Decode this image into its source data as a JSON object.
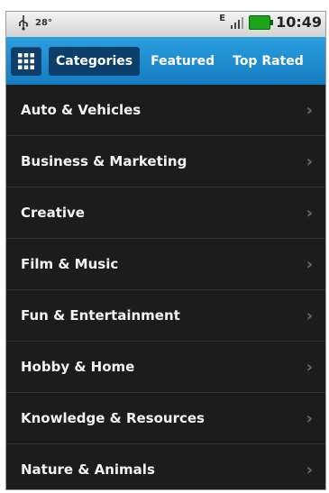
{
  "status_bar": {
    "temperature": "28°",
    "network": "E",
    "time": "10:49"
  },
  "tabs": [
    {
      "label": "Categories",
      "active": true
    },
    {
      "label": "Featured",
      "active": false
    },
    {
      "label": "Top Rated",
      "active": false
    }
  ],
  "categories": [
    {
      "label": "Auto & Vehicles"
    },
    {
      "label": "Business & Marketing"
    },
    {
      "label": "Creative"
    },
    {
      "label": "Film & Music"
    },
    {
      "label": "Fun & Entertainment"
    },
    {
      "label": "Hobby & Home"
    },
    {
      "label": "Knowledge & Resources"
    },
    {
      "label": "Nature & Animals"
    }
  ],
  "chevron": "›",
  "colors": {
    "tabbar": "#1e8fd3",
    "active_tab": "#0c3f6b",
    "list_background": "#1c1c1c",
    "battery": "#1aa51a"
  }
}
